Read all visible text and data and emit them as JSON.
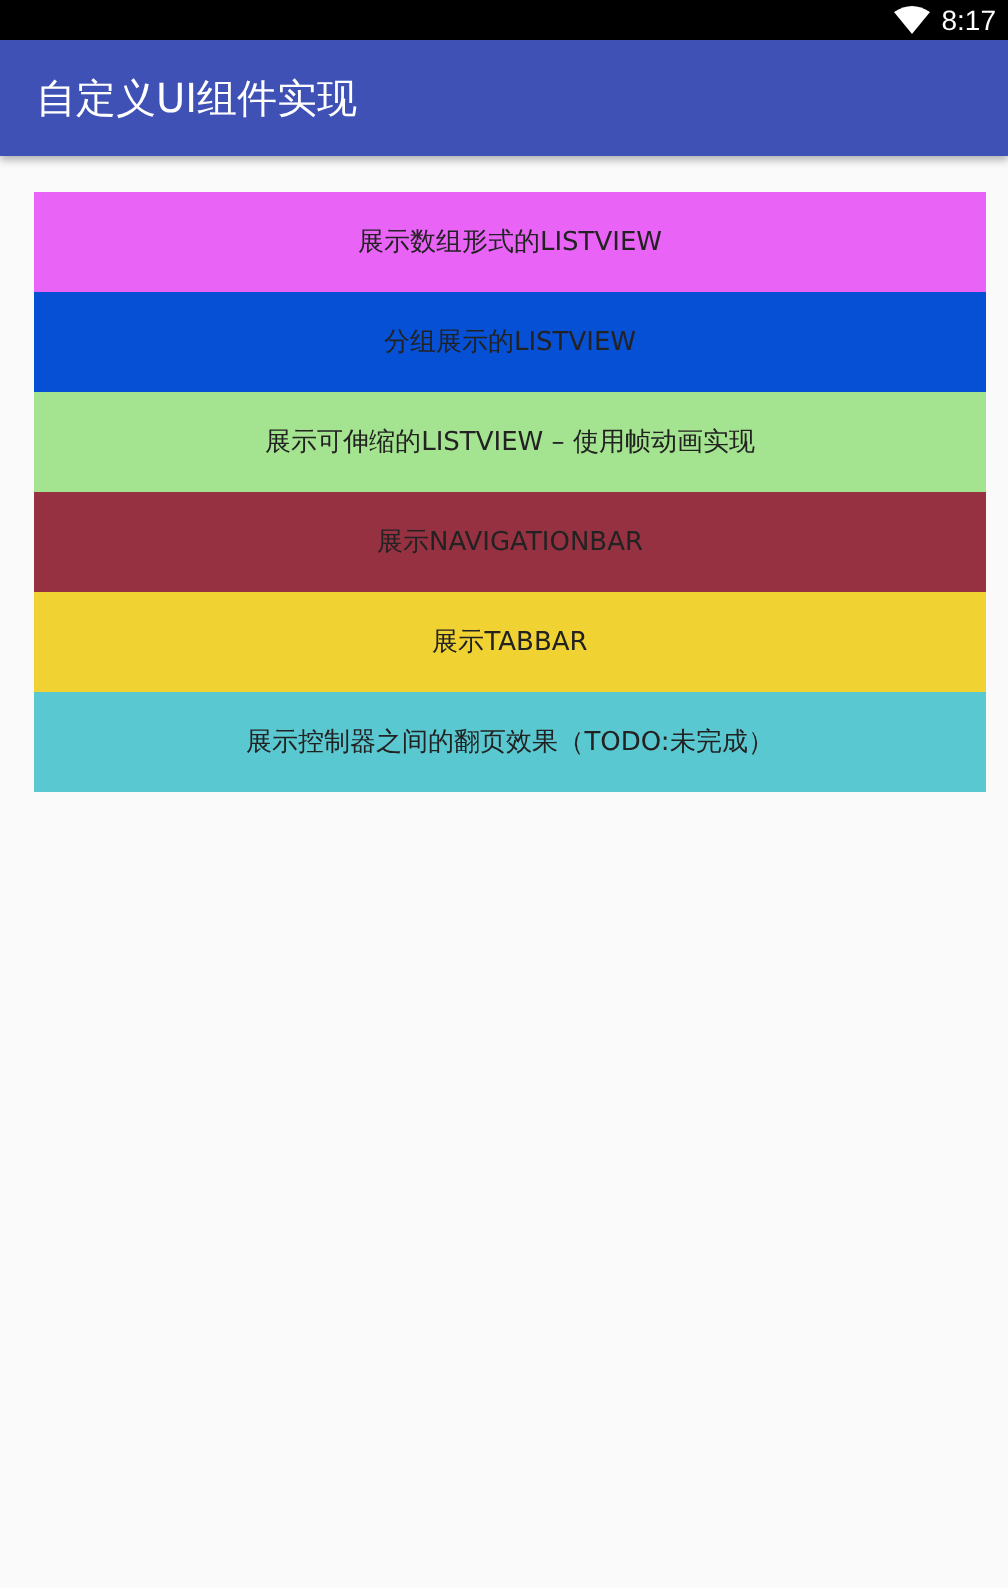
{
  "status_bar": {
    "time": "8:17"
  },
  "app_bar": {
    "title": "自定义UI组件实现"
  },
  "buttons": [
    {
      "label": "展示数组形式的LISTVIEW",
      "color": "#e963f7"
    },
    {
      "label": "分组展示的LISTVIEW",
      "color": "#0650d6"
    },
    {
      "label": "展示可伸缩的LISTVIEW – 使用帧动画实现",
      "color": "#a4e38f"
    },
    {
      "label": "展示NAVIGATIONBAR",
      "color": "#963142"
    },
    {
      "label": "展示TABBAR",
      "color": "#f0d232"
    },
    {
      "label": "展示控制器之间的翻页效果（TODO:未完成）",
      "color": "#5ac8d0"
    }
  ]
}
